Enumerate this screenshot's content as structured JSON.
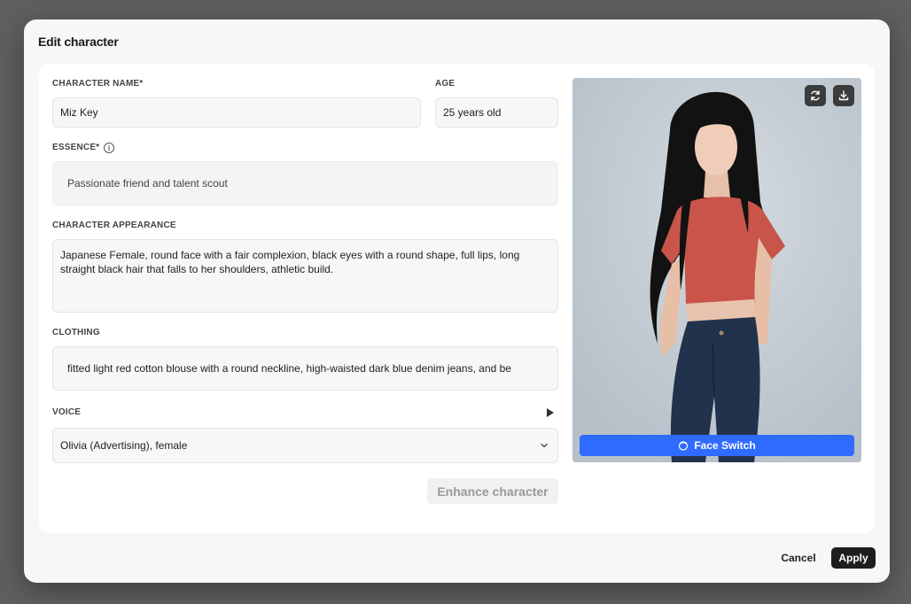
{
  "dialog": {
    "title": "Edit character"
  },
  "form": {
    "name": {
      "label": "CHARACTER NAME*",
      "value": "Miz Key"
    },
    "age": {
      "label": "AGE",
      "value": "25 years old"
    },
    "essence": {
      "label": "ESSENCE*",
      "value": "Passionate friend and talent scout",
      "info_icon": "info-icon"
    },
    "appearance": {
      "label": "CHARACTER APPEARANCE",
      "value": "Japanese Female, round face with a fair complexion, black eyes with a round shape, full lips, long straight black hair that falls to her shoulders, athletic build."
    },
    "clothing": {
      "label": "CLOTHING",
      "value": "fitted light red cotton blouse with a round neckline, high-waisted dark blue denim jeans, and be"
    },
    "voice": {
      "label": "VOICE",
      "value": "Olivia (Advertising), female",
      "play_icon": "play-icon",
      "dropdown_icon": "chevron-down-icon"
    },
    "enhance_label": "Enhance character"
  },
  "portrait": {
    "regenerate_icon": "refresh-icon",
    "download_icon": "download-icon",
    "face_switch_label": "Face Switch",
    "face_switch_icon": "face-icon",
    "colors": {
      "shirt": "#c9554a",
      "jeans": "#23324c",
      "hair": "#121212",
      "background": "#c6ced6"
    }
  },
  "footer": {
    "cancel_label": "Cancel",
    "apply_label": "Apply"
  },
  "colors": {
    "accent": "#2f6bff",
    "primary_button": "#1e1e1e",
    "overlay": "#5f5f5f"
  }
}
